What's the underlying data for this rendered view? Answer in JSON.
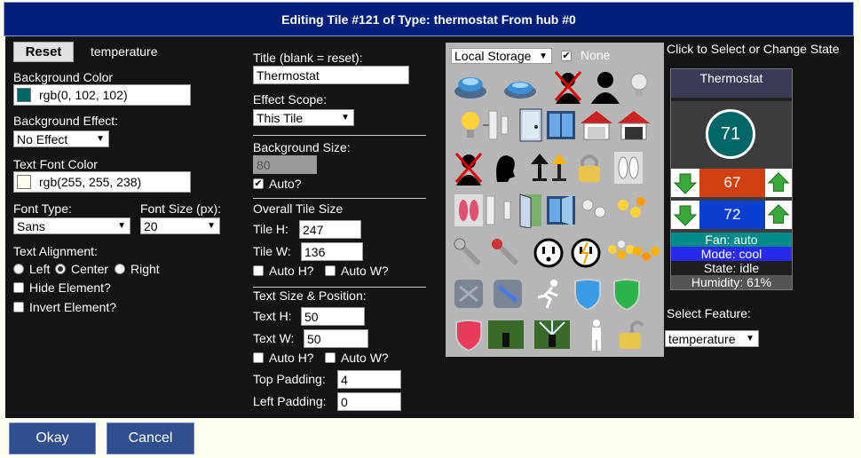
{
  "header": {
    "title": "Editing Tile #121 of Type: thermostat From hub #0"
  },
  "left": {
    "reset_label": "Reset",
    "feature_name": "temperature",
    "bg_color_label": "Background Color",
    "bg_color_value": "rgb(0, 102, 102)",
    "bg_color_hex": "#006666",
    "bg_effect_label": "Background Effect:",
    "bg_effect_value": "No Effect",
    "text_color_label": "Text Font Color",
    "text_color_value": "rgb(255, 255, 238)",
    "text_color_hex": "#ffffee",
    "font_type_label": "Font Type:",
    "font_type_value": "Sans",
    "font_size_label": "Font Size (px):",
    "font_size_value": "20",
    "align_label": "Text Alignment:",
    "align_left": "Left",
    "align_center": "Center",
    "align_right": "Right",
    "hide_label": "Hide Element?",
    "invert_label": "Invert Element?"
  },
  "middle": {
    "title_label": "Title (blank = reset):",
    "title_value": "Thermostat",
    "scope_label": "Effect Scope:",
    "scope_value": "This Tile",
    "bg_size_label": "Background Size:",
    "bg_size_value": "80",
    "auto_label": "Auto?",
    "overall_label": "Overall Tile Size",
    "tile_h_label": "Tile H:",
    "tile_h_value": "247",
    "tile_w_label": "Tile W:",
    "tile_w_value": "136",
    "auto_h_label": "Auto H?",
    "auto_w_label": "Auto W?",
    "text_size_label": "Text Size & Position:",
    "text_h_label": "Text H:",
    "text_h_value": "50",
    "text_w_label": "Text W:",
    "text_w_value": "50",
    "auto_h2_label": "Auto H?",
    "auto_w2_label": "Auto W?",
    "top_pad_label": "Top Padding:",
    "top_pad_value": "4",
    "left_pad_label": "Left Padding:",
    "left_pad_value": "0"
  },
  "icons": {
    "source_value": "Local Storage",
    "none_label": "None"
  },
  "preview": {
    "heading": "Click to Select or Change State",
    "tile_title": "Thermostat",
    "temperature": "71",
    "heat_setpoint": "67",
    "cool_setpoint": "72",
    "fan": "Fan: auto",
    "mode": "Mode: cool",
    "state": "State: idle",
    "humidity": "Humidity: 61%",
    "select_feature_label": "Select Feature:",
    "select_feature_value": "temperature"
  },
  "footer": {
    "ok_label": "Okay",
    "cancel_label": "Cancel"
  },
  "colors": {
    "header_bg": "#001f7a",
    "panel_bg": "#141414",
    "heat": "#d04010",
    "cool": "#0a3fd0",
    "fan_bg": "#008a8a",
    "mode_bg": "#2a2aee",
    "button_bg": "#2f4f8e"
  }
}
